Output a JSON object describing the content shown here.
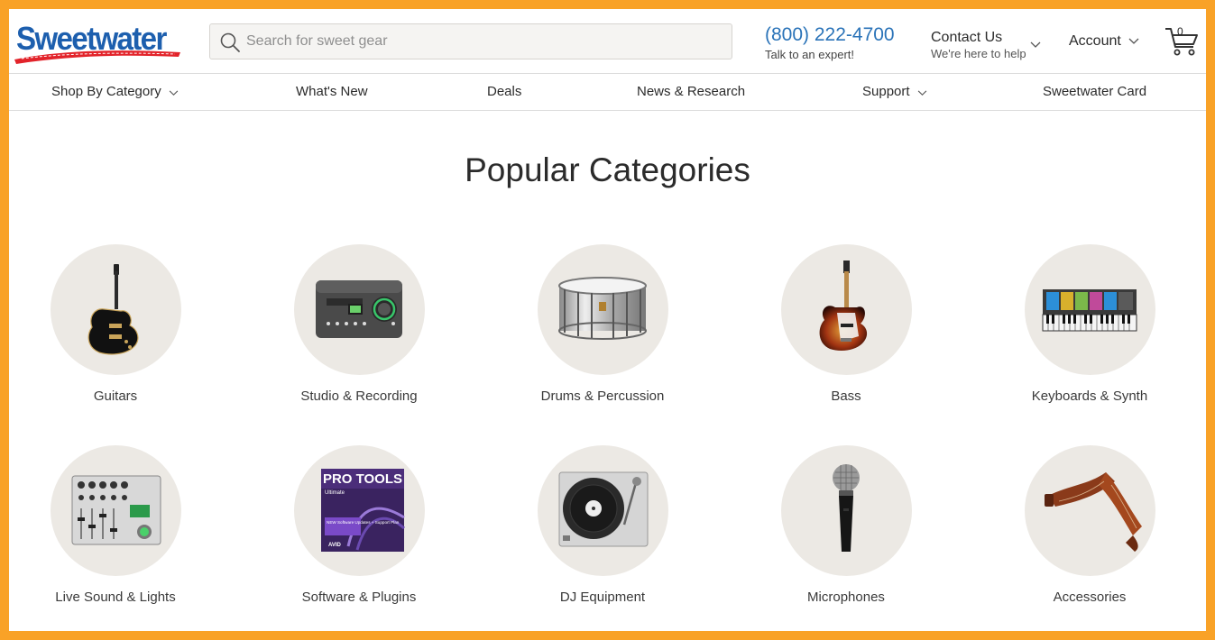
{
  "brand": {
    "name": "Sweetwater"
  },
  "search": {
    "placeholder": "Search for sweet gear"
  },
  "phone": {
    "number": "(800) 222-4700",
    "subtitle": "Talk to an expert!"
  },
  "contact": {
    "title": "Contact Us",
    "subtitle": "We're here to help"
  },
  "account": {
    "label": "Account"
  },
  "cart": {
    "count": "0"
  },
  "nav": {
    "items": [
      {
        "label": "Shop By Category",
        "dropdown": true
      },
      {
        "label": "What's New",
        "dropdown": false
      },
      {
        "label": "Deals",
        "dropdown": false
      },
      {
        "label": "News & Research",
        "dropdown": false
      },
      {
        "label": "Support",
        "dropdown": true
      },
      {
        "label": "Sweetwater Card",
        "dropdown": false
      }
    ]
  },
  "main": {
    "title": "Popular Categories",
    "categories": [
      {
        "label": "Guitars",
        "icon": "electric-guitar-icon"
      },
      {
        "label": "Studio & Recording",
        "icon": "audio-interface-icon"
      },
      {
        "label": "Drums & Percussion",
        "icon": "snare-drum-icon"
      },
      {
        "label": "Bass",
        "icon": "bass-guitar-icon"
      },
      {
        "label": "Keyboards & Synth",
        "icon": "synthesizer-icon"
      },
      {
        "label": "Live Sound & Lights",
        "icon": "mixer-icon"
      },
      {
        "label": "Software & Plugins",
        "icon": "pro-tools-box-icon"
      },
      {
        "label": "DJ Equipment",
        "icon": "turntable-icon"
      },
      {
        "label": "Microphones",
        "icon": "microphone-icon"
      },
      {
        "label": "Accessories",
        "icon": "guitar-strap-icon"
      }
    ],
    "product_text": {
      "pro_tools_title": "PRO TOOLS",
      "pro_tools_edition": "Ultimate",
      "pro_tools_badge": "NEW Software Updates + Support Plan",
      "pro_tools_maker": "AVID"
    }
  },
  "colors": {
    "frame": "#f9a227",
    "brand_blue": "#1d5fae",
    "phone_blue": "#2a73b8",
    "circle_bg": "#ece9e4",
    "logo_red": "#e2232a"
  }
}
